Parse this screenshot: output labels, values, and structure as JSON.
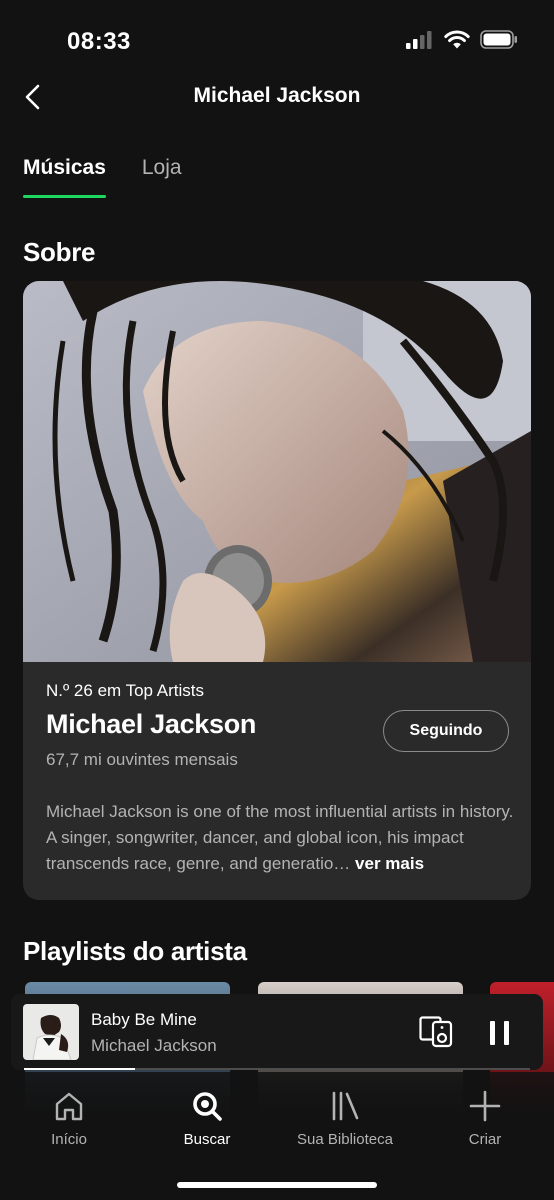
{
  "status_bar": {
    "time": "08:33"
  },
  "header": {
    "title": "Michael Jackson"
  },
  "tabs": [
    {
      "label": "Músicas"
    },
    {
      "label": "Loja"
    }
  ],
  "about": {
    "section_title": "Sobre",
    "rank": "N.º 26 em Top Artists",
    "artist_name": "Michael Jackson",
    "listeners": "67,7 mi ouvintes mensais",
    "follow_label": "Seguindo",
    "bio": "Michael Jackson is one of the most influential artists in history. A singer, songwriter, dancer, and global icon, his impact transcends race, genre, and generatio…",
    "more_label": "ver mais"
  },
  "playlists": {
    "section_title": "Playlists do artista"
  },
  "now_playing": {
    "track": "Baby Be Mine",
    "artist": "Michael Jackson",
    "progress": 0.22
  },
  "nav": [
    {
      "label": "Início",
      "icon": "home-icon"
    },
    {
      "label": "Buscar",
      "icon": "search-icon"
    },
    {
      "label": "Sua Biblioteca",
      "icon": "library-icon"
    },
    {
      "label": "Criar",
      "icon": "plus-icon"
    }
  ],
  "colors": {
    "accent": "#1ed760",
    "background": "#121212",
    "card": "#2a2a2a"
  }
}
